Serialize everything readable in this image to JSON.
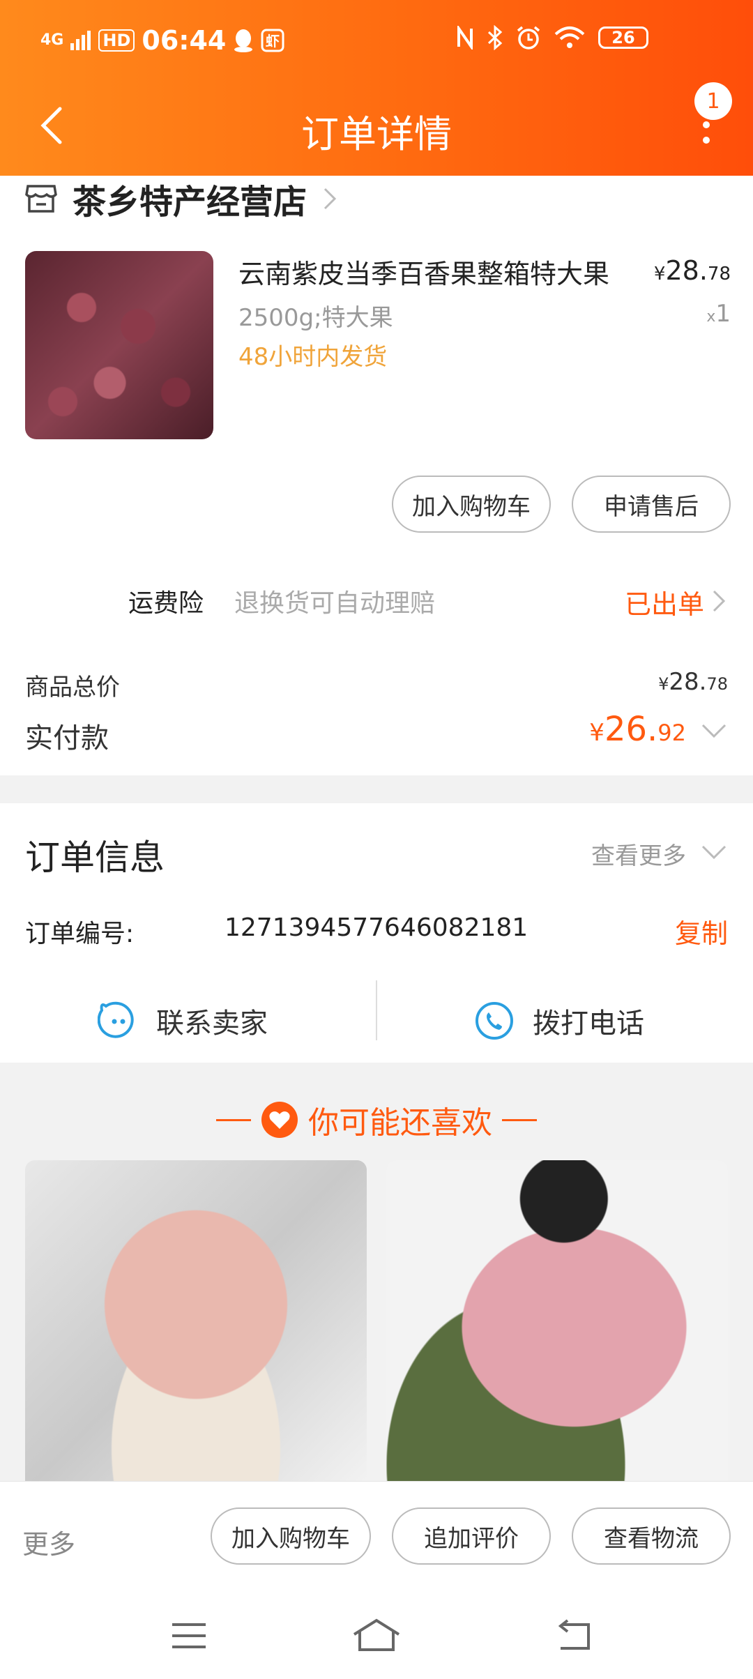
{
  "status_bar": {
    "network": "4G",
    "hd": "HD",
    "time": "06:44",
    "battery": "26"
  },
  "header": {
    "title": "订单详情",
    "badge": "1"
  },
  "store": {
    "name": "茶乡特产经营店"
  },
  "product": {
    "name": "云南紫皮当季百香果整箱特大果",
    "spec": "2500g;特大果",
    "shipping": "48小时内发货",
    "price_currency": "¥",
    "price_int": "28.",
    "price_dec": "78",
    "qty_prefix": "x",
    "qty": "1"
  },
  "item_actions": {
    "add_cart": "加入购物车",
    "after_sale": "申请售后"
  },
  "insurance": {
    "label": "运费险",
    "desc": "退换货可自动理赔",
    "status": "已出单"
  },
  "summary": {
    "total_label": "商品总价",
    "total_currency": "¥",
    "total_int": "28.",
    "total_dec": "78",
    "paid_label": "实付款",
    "paid_currency": "¥",
    "paid_int": "26.",
    "paid_dec": "92"
  },
  "order_info": {
    "title": "订单信息",
    "more": "查看更多",
    "number_label": "订单编号:",
    "number": "1271394577646082181",
    "copy": "复制"
  },
  "contact": {
    "seller": "联系卖家",
    "phone": "拨打电话"
  },
  "recommend": {
    "title": "你可能还喜欢"
  },
  "bottom_bar": {
    "more": "更多",
    "add_cart": "加入购物车",
    "add_review": "追加评价",
    "logistics": "查看物流"
  },
  "colors": {
    "accent": "#ff5a10",
    "header_start": "#ff8a1c",
    "header_end": "#ff4e0a",
    "ship_text": "#f0a43a",
    "contact_icon": "#2a9fe0"
  }
}
